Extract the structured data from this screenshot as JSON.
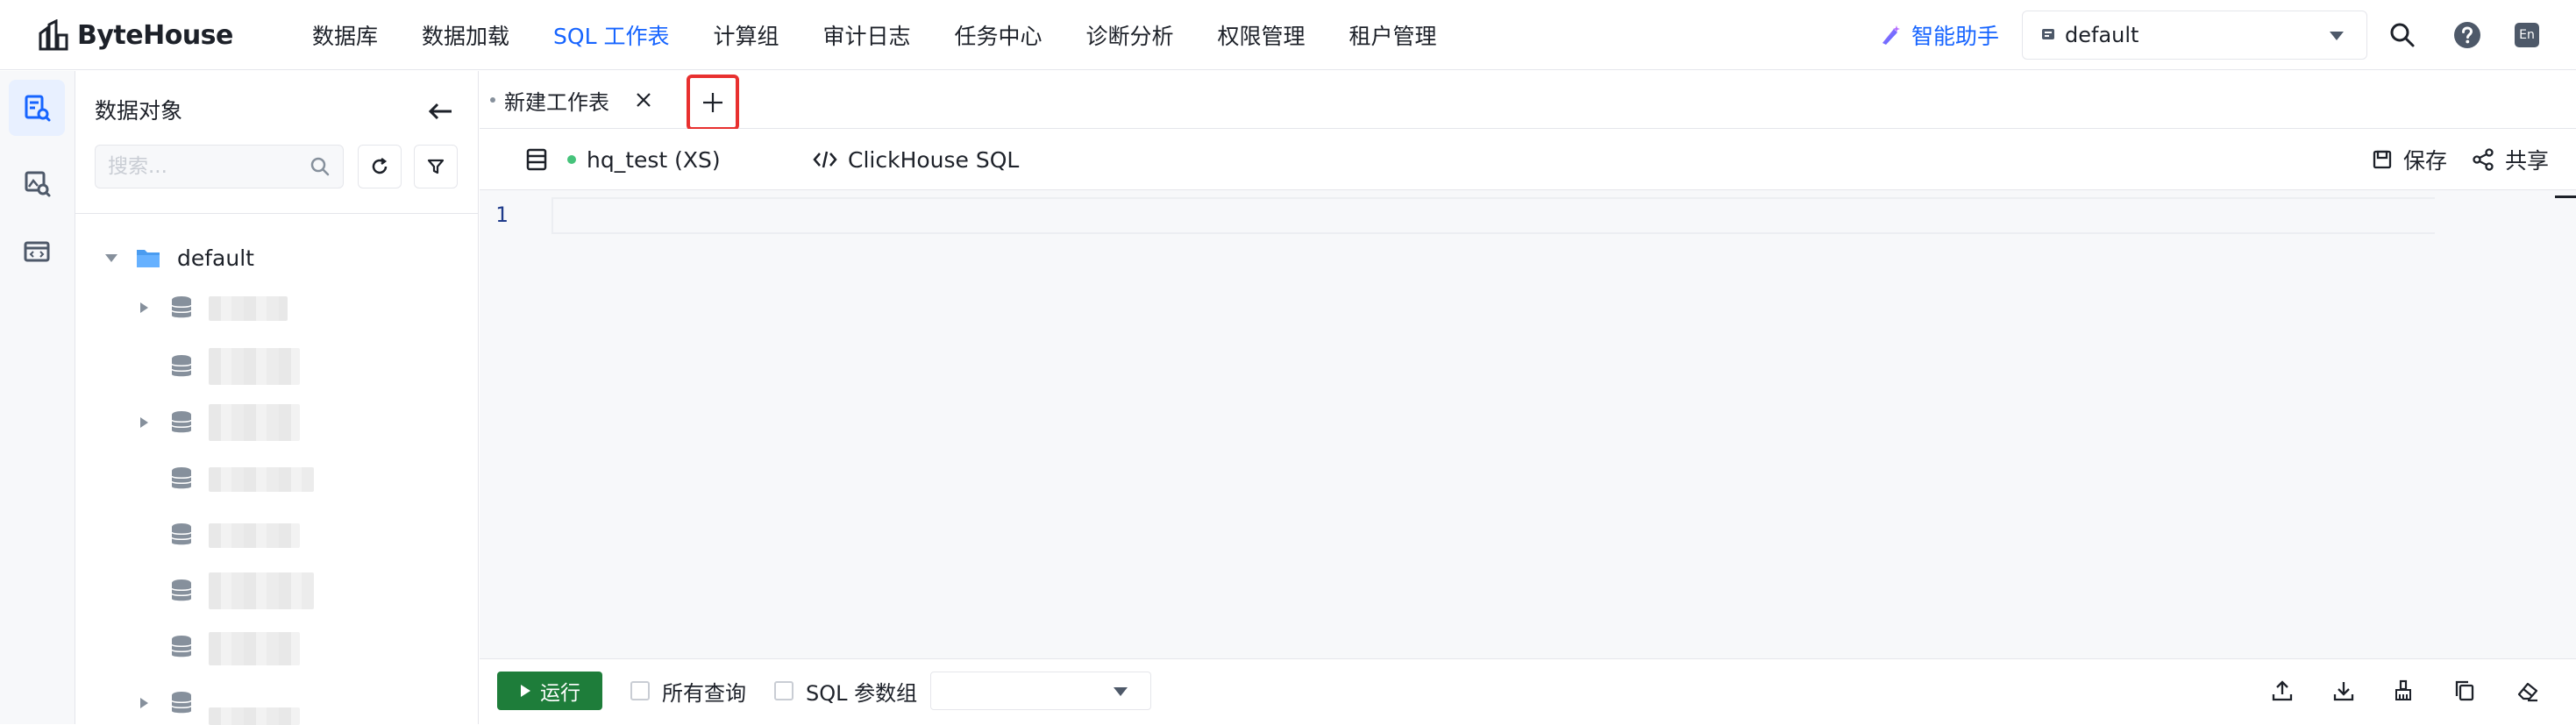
{
  "app": {
    "logo_text": "ByteHouse"
  },
  "nav": {
    "items": [
      {
        "label": "数据库"
      },
      {
        "label": "数据加载"
      },
      {
        "label": "SQL 工作表"
      },
      {
        "label": "计算组"
      },
      {
        "label": "审计日志"
      },
      {
        "label": "任务中心"
      },
      {
        "label": "诊断分析"
      },
      {
        "label": "权限管理"
      },
      {
        "label": "租户管理"
      }
    ],
    "active": "SQL 工作表"
  },
  "header": {
    "assistant_label": "智能助手",
    "workspace_value": "default",
    "lang_badge": "En"
  },
  "sidebar": {
    "title": "数据对象",
    "search_placeholder": "搜索...",
    "root_label": "default"
  },
  "tabs": {
    "items": [
      {
        "label": "新建工作表"
      }
    ],
    "add_symbol": "+"
  },
  "toolbar": {
    "compute_group": "hq_test (XS)",
    "dialect": "ClickHouse SQL",
    "save_label": "保存",
    "share_label": "共享"
  },
  "editor": {
    "line_numbers": [
      "1"
    ]
  },
  "footer": {
    "run_label": "运行",
    "all_queries_label": "所有查询",
    "param_group_label": "SQL 参数组"
  },
  "colors": {
    "accent": "#1664ff",
    "run_button": "#1e7d3a",
    "highlight_border": "#e8302f",
    "status_online": "#46c37b",
    "folder": "#4a9cf0"
  }
}
